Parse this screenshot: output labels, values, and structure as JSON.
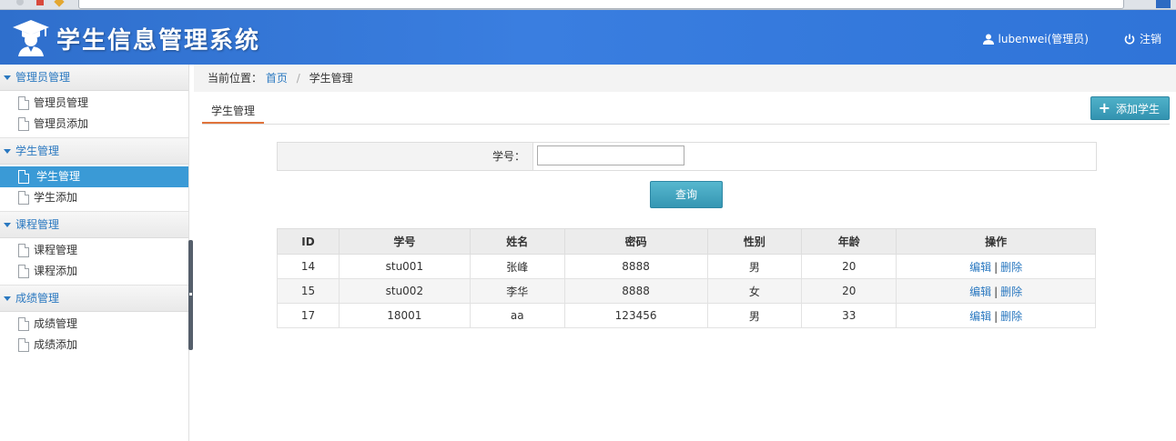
{
  "header": {
    "title": "学生信息管理系统",
    "user": "lubenwei(管理员)",
    "logout": "注销"
  },
  "sidebar": {
    "groups": [
      {
        "title": "管理员管理",
        "items": [
          {
            "label": "管理员管理"
          },
          {
            "label": "管理员添加"
          }
        ]
      },
      {
        "title": "学生管理",
        "items": [
          {
            "label": "学生管理",
            "active": true
          },
          {
            "label": "学生添加"
          }
        ]
      },
      {
        "title": "课程管理",
        "items": [
          {
            "label": "课程管理"
          },
          {
            "label": "课程添加"
          }
        ]
      },
      {
        "title": "成绩管理",
        "items": [
          {
            "label": "成绩管理"
          },
          {
            "label": "成绩添加"
          }
        ]
      }
    ]
  },
  "breadcrumb": {
    "prefix": "当前位置：",
    "home": "首页",
    "separator": "/",
    "current": "学生管理"
  },
  "tab": {
    "label": "学生管理"
  },
  "add_button": {
    "label": "添加学生"
  },
  "search": {
    "label": "学号：",
    "value": "",
    "button": "查询"
  },
  "table": {
    "columns": [
      "ID",
      "学号",
      "姓名",
      "密码",
      "性别",
      "年龄",
      "操作"
    ],
    "rows": [
      {
        "id": "14",
        "sno": "stu001",
        "name": "张峰",
        "password": "8888",
        "gender": "男",
        "age": "20",
        "edit": "编辑",
        "sep": "|",
        "delete": "删除"
      },
      {
        "id": "15",
        "sno": "stu002",
        "name": "李华",
        "password": "8888",
        "gender": "女",
        "age": "20",
        "edit": "编辑",
        "sep": "|",
        "delete": "删除"
      },
      {
        "id": "17",
        "sno": "18001",
        "name": "aa",
        "password": "123456",
        "gender": "男",
        "age": "33",
        "edit": "编辑",
        "sep": "|",
        "delete": "删除"
      }
    ]
  },
  "colors": {
    "header_blue": "#2f6fcc",
    "link_blue": "#2a78c0",
    "active_item": "#3a9ad6",
    "button_teal": "#3596b3",
    "tab_underline": "#e0743c"
  }
}
